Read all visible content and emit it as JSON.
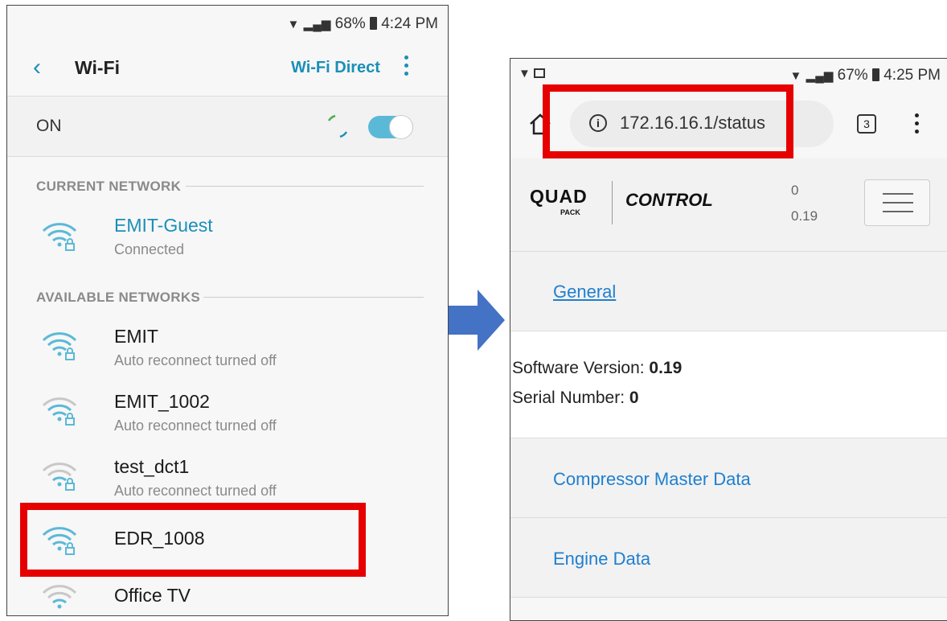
{
  "left_phone": {
    "status_bar": {
      "battery": "68%",
      "time": "4:24 PM"
    },
    "header": {
      "title": "Wi-Fi",
      "wifi_direct": "Wi-Fi Direct"
    },
    "toggle_label": "ON",
    "current_section": "CURRENT NETWORK",
    "current_network": {
      "name": "EMIT-Guest",
      "status": "Connected"
    },
    "available_section": "AVAILABLE NETWORKS",
    "networks": [
      {
        "name": "EMIT",
        "status": "Auto reconnect turned off"
      },
      {
        "name": "EMIT_1002",
        "status": "Auto reconnect turned off"
      },
      {
        "name": "test_dct1",
        "status": "Auto reconnect turned off"
      },
      {
        "name": "EDR_1008",
        "status": ""
      },
      {
        "name": "Office TV",
        "status": ""
      }
    ]
  },
  "right_phone": {
    "status_bar": {
      "battery": "67%",
      "time": "4:25 PM"
    },
    "browser": {
      "url": "172.16.16.1/status",
      "tab_count": "3"
    },
    "header": {
      "logo_main": "QUAD",
      "logo_sub": "PACK",
      "brand": "CONTROL",
      "top_value": "0",
      "bottom_value": "0.19"
    },
    "general_link": "General",
    "software_label": "Software Version: ",
    "software_value": "0.19",
    "serial_label": "Serial Number: ",
    "serial_value": "0",
    "menu_items": [
      "Compressor Master Data",
      "Engine Data"
    ]
  },
  "colors": {
    "accent": "#1a8fb8",
    "highlight": "#e60000",
    "link": "#1f7fcf",
    "arrow": "#4472c4"
  }
}
